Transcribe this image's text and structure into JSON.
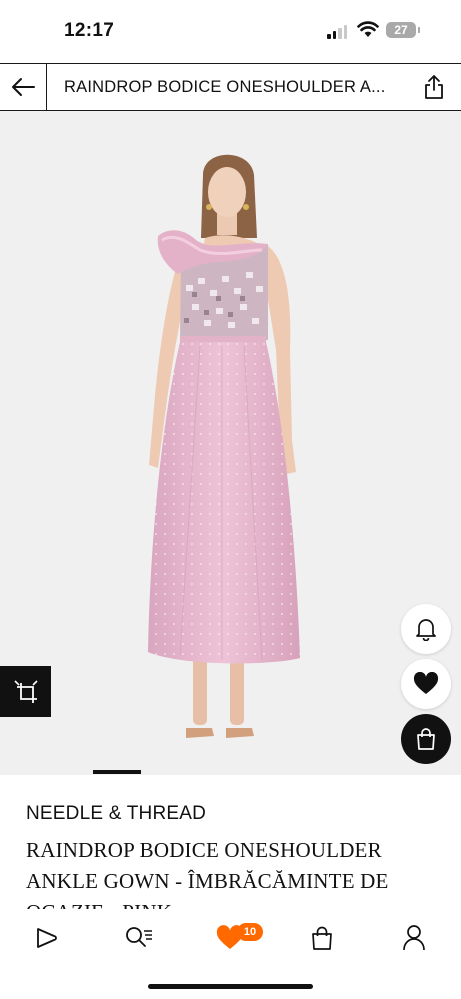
{
  "status_bar": {
    "time": "12:17",
    "battery": "27"
  },
  "header": {
    "title": "RAINDROP BODICE ONESHOULDER A..."
  },
  "product": {
    "brand": "NEEDLE & THREAD",
    "name": "RAINDROP BODICE ONESHOULDER ANKLE GOWN - ÎMBRĂCĂMINTE DE OCAZIE - PINK"
  },
  "icons": {
    "back": "arrow-left-icon",
    "share": "share-icon",
    "bell": "bell-icon",
    "heart": "heart-icon",
    "bag": "shopping-bag-icon",
    "view_toggle": "view-toggle-icon"
  },
  "tab_bar": {
    "wishlist_count": "10",
    "items": [
      "home-icon",
      "search-icon",
      "wishlist-heart-icon",
      "bag-icon",
      "account-icon"
    ]
  },
  "colors": {
    "accent": "#ff6900",
    "dress": "#e7b9cf",
    "image_background": "#f0f0f0"
  }
}
